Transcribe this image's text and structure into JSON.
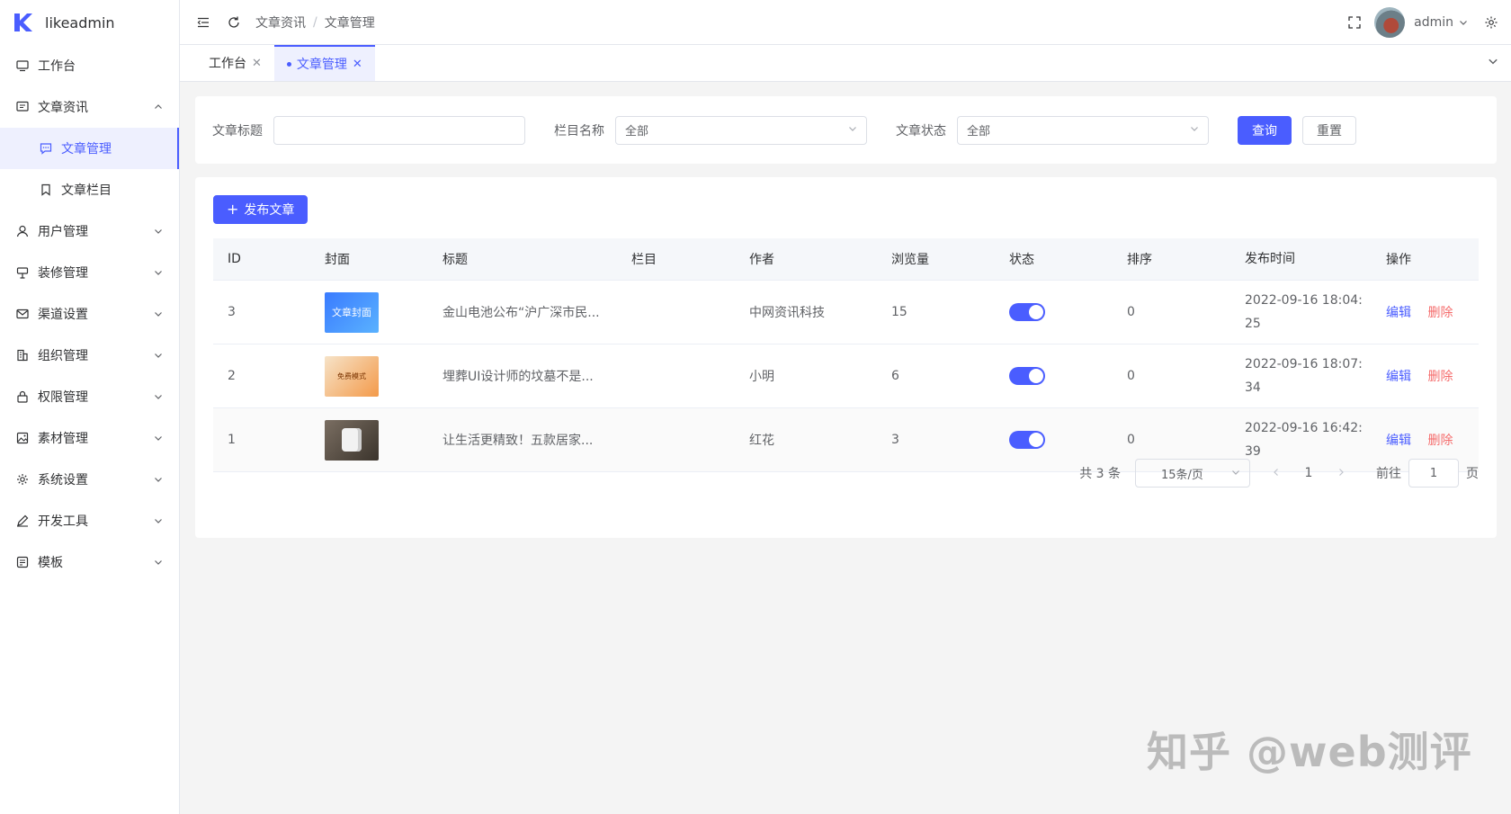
{
  "app": {
    "name": "likeadmin",
    "brand_color": "#4a5dff"
  },
  "sidebar": {
    "items": [
      {
        "label": "工作台",
        "icon": "monitor-icon",
        "expandable": false
      },
      {
        "label": "文章资讯",
        "icon": "message-icon",
        "expandable": true,
        "expanded": true,
        "children": [
          {
            "label": "文章管理",
            "icon": "chat-icon",
            "active": true
          },
          {
            "label": "文章栏目",
            "icon": "bookmark-icon",
            "active": false
          }
        ]
      },
      {
        "label": "用户管理",
        "icon": "user-icon",
        "expandable": true
      },
      {
        "label": "装修管理",
        "icon": "decoration-icon",
        "expandable": true
      },
      {
        "label": "渠道设置",
        "icon": "mail-icon",
        "expandable": true
      },
      {
        "label": "组织管理",
        "icon": "building-icon",
        "expandable": true
      },
      {
        "label": "权限管理",
        "icon": "lock-icon",
        "expandable": true
      },
      {
        "label": "素材管理",
        "icon": "image-icon",
        "expandable": true
      },
      {
        "label": "系统设置",
        "icon": "gear-icon",
        "expandable": true
      },
      {
        "label": "开发工具",
        "icon": "pen-icon",
        "expandable": true
      },
      {
        "label": "模板",
        "icon": "template-icon",
        "expandable": true
      }
    ]
  },
  "header": {
    "breadcrumb": [
      "文章资讯",
      "文章管理"
    ],
    "breadcrumb_sep": "/",
    "user": "admin"
  },
  "tabs": [
    {
      "label": "工作台",
      "active": false
    },
    {
      "label": "文章管理",
      "active": true
    }
  ],
  "filters": {
    "title_label": "文章标题",
    "title_value": "",
    "category_label": "栏目名称",
    "category_value": "全部",
    "status_label": "文章状态",
    "status_value": "全部",
    "query_button": "查询",
    "reset_button": "重置"
  },
  "table": {
    "add_button": "发布文章",
    "columns": [
      "ID",
      "封面",
      "标题",
      "栏目",
      "作者",
      "浏览量",
      "状态",
      "排序",
      "发布时间",
      "操作"
    ],
    "rows": [
      {
        "id": "3",
        "cover_text": "文章封面",
        "title": "金山电池公布“沪广深市民...",
        "category": "",
        "author": "中网资讯科技",
        "views": "15",
        "status_on": true,
        "sort": "0",
        "time_line1": "2022-09-16 18:04:",
        "time_line2": "25",
        "edit": "编辑",
        "delete": "删除"
      },
      {
        "id": "2",
        "cover_text": "免费模式",
        "title": "埋葬UI设计师的坟墓不是...",
        "category": "",
        "author": "小明",
        "views": "6",
        "status_on": true,
        "sort": "0",
        "time_line1": "2022-09-16 18:07:",
        "time_line2": "34",
        "edit": "编辑",
        "delete": "删除"
      },
      {
        "id": "1",
        "cover_text": "",
        "title": "让生活更精致！五款居家...",
        "category": "",
        "author": "红花",
        "views": "3",
        "status_on": true,
        "sort": "0",
        "time_line1": "2022-09-16 16:42:",
        "time_line2": "39",
        "edit": "编辑",
        "delete": "删除"
      }
    ]
  },
  "pagination": {
    "total_text": "共 3 条",
    "page_size": "15条/页",
    "current_page": "1",
    "goto_label": "前往",
    "goto_value": "1",
    "goto_unit": "页"
  },
  "watermark": "知乎 @web测评"
}
